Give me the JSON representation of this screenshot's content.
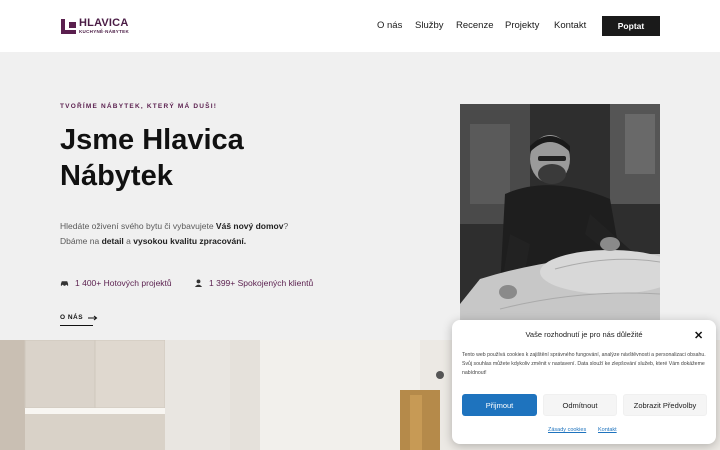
{
  "header": {
    "logo_main": "HLAVICA",
    "logo_sub": "KUCHYNĚ·NÁBYTEK",
    "nav": [
      "O nás",
      "Služby",
      "Recenze",
      "Projekty",
      "Kontakt"
    ],
    "cta": "Poptat"
  },
  "hero": {
    "eyebrow": "TVOŘÍME NÁBYTEK, KTERÝ MÁ DUŠI!",
    "title_line1": "Jsme Hlavica",
    "title_line2": "Nábytek",
    "desc_p1_a": "Hledáte oživení svého bytu či vybavujete ",
    "desc_p1_b": "Váš nový domov",
    "desc_p1_c": "?",
    "desc_p2_a": "Dbáme na ",
    "desc_p2_b": "detail",
    "desc_p2_c": " a ",
    "desc_p2_d": "vysokou kvalitu zpracování.",
    "stat1": "1 400+ Hotových projektů",
    "stat2": "1 399+ Spokojených klientů",
    "about_link": "O NÁS"
  },
  "cookie": {
    "title": "Vaše rozhodnutí je pro nás důležité",
    "text": "Tento web používá cookies k zajištění správného fungování, analýze návštěvnosti a personalizaci obsahu. Svůj souhlas můžete kdykoliv změnit v nastavení. Data slouží ke zlepšování služeb, které Vám dokážeme nabídnout!",
    "accept": "Přijmout",
    "deny": "Odmítnout",
    "prefs": "Zobrazit Předvolby",
    "link1": "Zásady cookies",
    "link2": "Kontakt"
  },
  "colors": {
    "brand": "#5a1f4e",
    "accept": "#1e73be",
    "dark": "#1a1a1a"
  }
}
